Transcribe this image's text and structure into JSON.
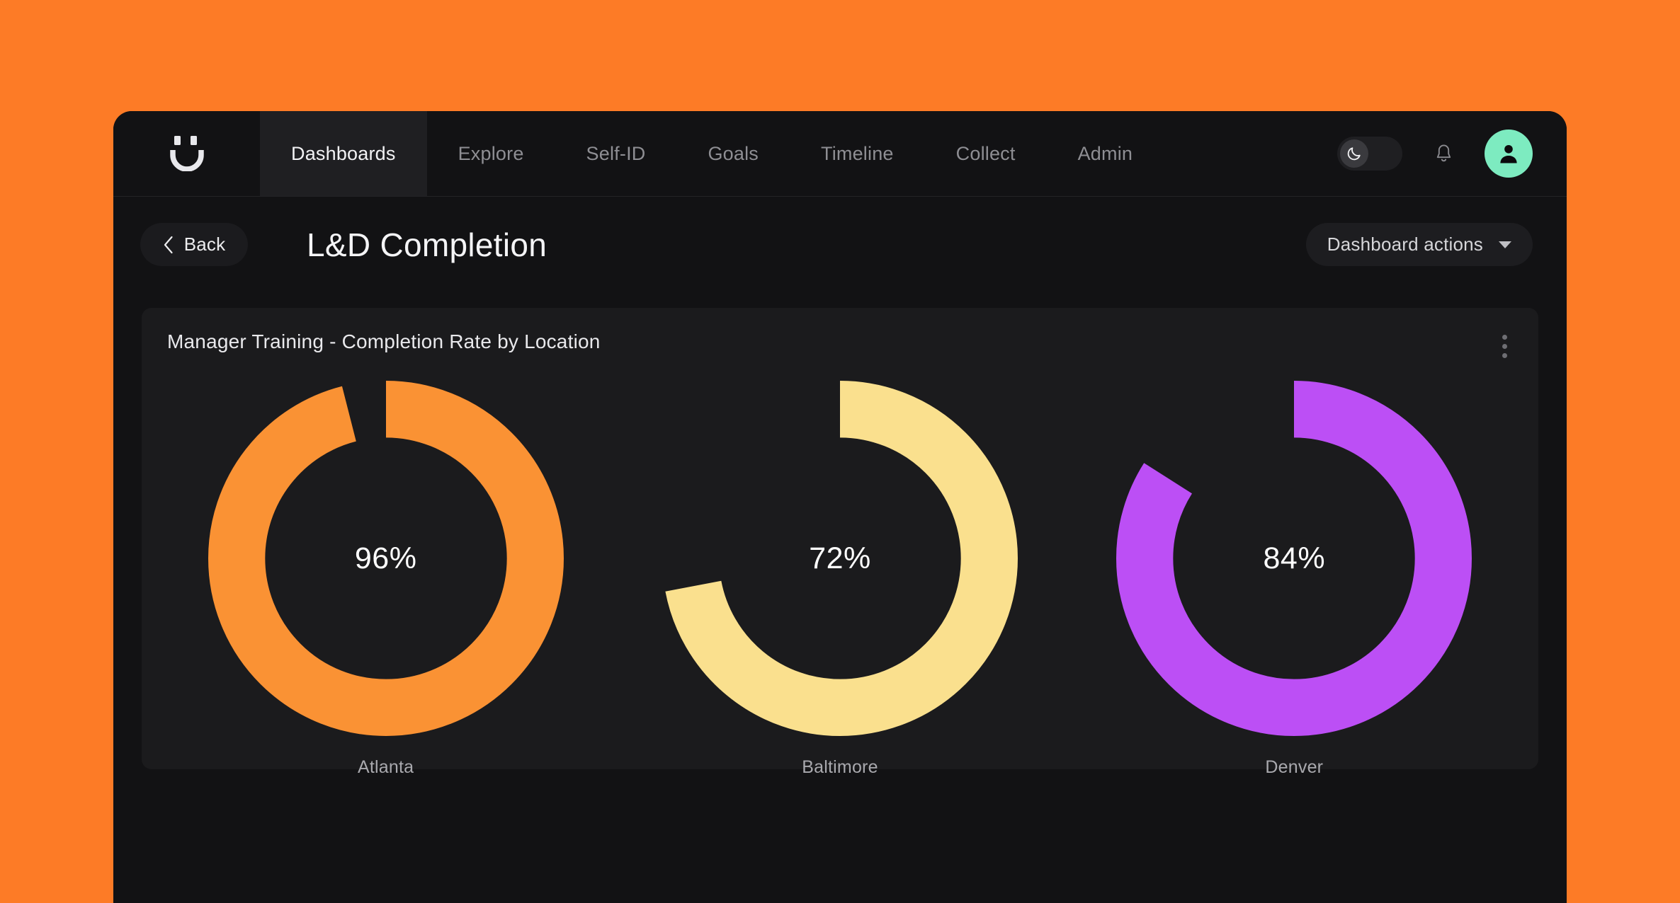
{
  "theme": {
    "page_background": "#FD7B26",
    "app_background": "#121214",
    "card_background": "#1B1B1D",
    "avatar_color": "#7DEBC0"
  },
  "topnav": {
    "logo_name": "smiley-face-logo",
    "tabs": [
      {
        "label": "Dashboards",
        "active": true
      },
      {
        "label": "Explore",
        "active": false
      },
      {
        "label": "Self-ID",
        "active": false
      },
      {
        "label": "Goals",
        "active": false
      },
      {
        "label": "Timeline",
        "active": false
      },
      {
        "label": "Collect",
        "active": false
      },
      {
        "label": "Admin",
        "active": false
      }
    ],
    "theme_toggle": {
      "icon": "moon-icon",
      "state": "dark"
    },
    "notifications": {
      "icon": "bell-icon"
    },
    "avatar": {
      "icon": "user-icon"
    }
  },
  "page_header": {
    "back_label": "Back",
    "back_icon": "chevron-left-icon",
    "title": "L&D Completion",
    "actions_label": "Dashboard actions",
    "actions_icon": "chevron-down-icon"
  },
  "card": {
    "title": "Manager Training - Completion Rate by Location",
    "menu_icon": "kebab-menu-icon"
  },
  "chart_data": {
    "type": "pie",
    "title": "Manager Training - Completion Rate by Location",
    "subtitle": "",
    "xlabel": "",
    "ylabel": "",
    "unit": "%",
    "legend": "none",
    "grid": false,
    "ylim": [
      0,
      100
    ],
    "categories": [
      "Atlanta",
      "Baltimore",
      "Denver"
    ],
    "values": [
      96,
      72,
      84
    ],
    "value_labels": [
      "96%",
      "72%",
      "84%"
    ],
    "colors": [
      "#FA9234",
      "#FAE08E",
      "#BC4FF5"
    ],
    "series": [
      {
        "name": "Completion Rate",
        "points": [
          {
            "category": "Atlanta",
            "value": 96,
            "label": "96%",
            "color": "#FA9234"
          },
          {
            "category": "Baltimore",
            "value": 72,
            "label": "72%",
            "color": "#FAE08E"
          },
          {
            "category": "Denver",
            "value": 84,
            "label": "84%",
            "color": "#BC4FF5"
          }
        ]
      }
    ]
  }
}
